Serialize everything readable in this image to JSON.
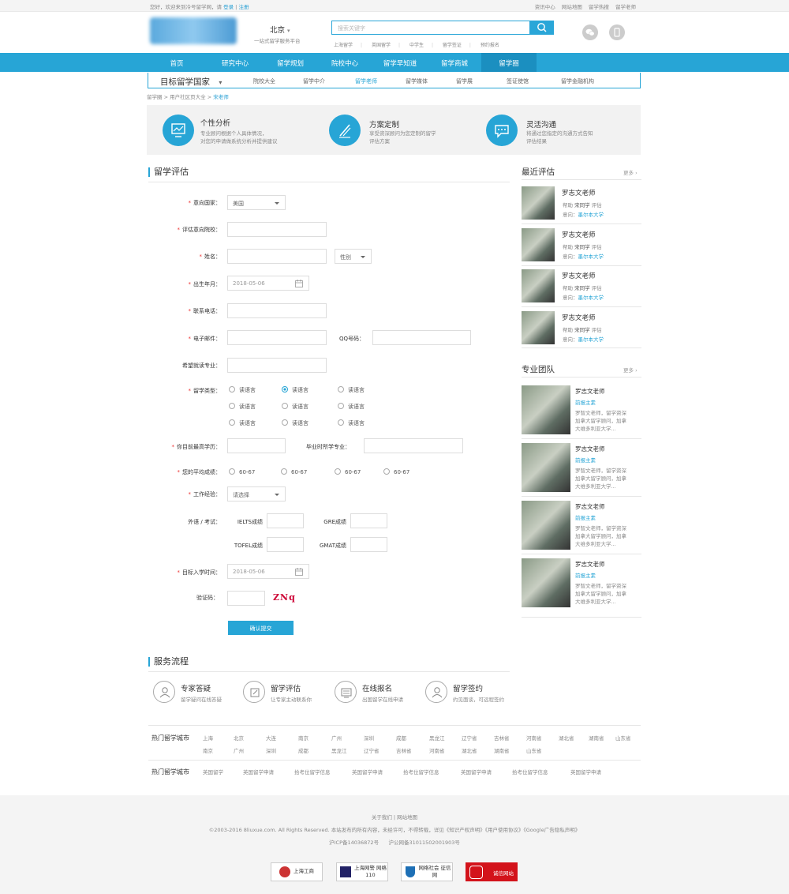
{
  "topbar": {
    "welcome": "您好，欢迎来到冷号留学网，请",
    "login": "登录",
    "sep": "|",
    "register": "注册",
    "links": [
      "资讯中心",
      "网站地图",
      "留学热搜",
      "留学老师"
    ]
  },
  "header": {
    "city": "北京",
    "city_sub": "一站式留学服务平台",
    "search_placeholder": "搜索关键字",
    "hotwords": [
      "上海留学",
      "英国留学",
      "中学生",
      "留学签证",
      "预约报名"
    ]
  },
  "nav": {
    "items": [
      "首页",
      "研究中心",
      "留学规划",
      "院校中心",
      "留学早知道",
      "留学商城",
      "留学圈"
    ],
    "active": 6
  },
  "subnav": {
    "title": "目标留学国家",
    "items": [
      "院校大全",
      "留学中介",
      "留学老师",
      "留学媒体",
      "留学展",
      "签证使馆",
      "留学金融机构"
    ],
    "active": 2
  },
  "breadcrumb": {
    "items": [
      "留学圈",
      "用户社区页大全"
    ],
    "current": "宋老师",
    "sep": ">"
  },
  "features": [
    {
      "title": "个性分析",
      "desc1": "专业顾问根据个人具体情况，",
      "desc2": "对您的申请做系统分析并提供建议"
    },
    {
      "title": "方案定制",
      "desc1": "享受资深顾问为您定制的留学",
      "desc2": "评估方案"
    },
    {
      "title": "灵活沟通",
      "desc1": "将通过您指定的沟通方式告知",
      "desc2": "评估结果"
    }
  ],
  "form": {
    "title": "留学评估",
    "required_mark": "*",
    "country_label": "意向国家：",
    "country_value": "美国",
    "school_label": "评估意向院校：",
    "name_label": "姓名：",
    "gender_value": "性别",
    "birth_label": "出生年月：",
    "birth_value": "2018-05-06",
    "phone_label": "联系电话：",
    "email_label": "电子邮件：",
    "qq_label": "QQ号码：",
    "major_label": "希望就读专业：",
    "type_label": "留学类型：",
    "type_options": [
      "读语言",
      "读语言",
      "读语言",
      "读语言",
      "读语言",
      "读语言",
      "读语言",
      "读语言",
      "读语言"
    ],
    "type_selected": 1,
    "edu_label": "你目前最高学历：",
    "grad_major_label": "毕业时所学专业：",
    "gpa_label": "您的平均成绩：",
    "gpa_options": [
      "60-67",
      "60-67",
      "60-67",
      "60-67"
    ],
    "work_label": "工作经验：",
    "work_value": "请选择",
    "lang_label": "外语 / 考试：",
    "ielts_label": "IELTS成绩",
    "gre_label": "GRE成绩",
    "toefl_label": "TOFEL成绩",
    "gmat_label": "GMAT成绩",
    "enroll_label": "目标入学时间：",
    "enroll_value": "2018-05-06",
    "captcha_label": "验证码：",
    "captcha_text": "ZNq",
    "submit": "确认提交"
  },
  "recent": {
    "title": "最近评估",
    "more": "更多",
    "items": [
      {
        "name": "罗志文老师",
        "help": "帮助",
        "student": "宋同学",
        "action": "评估",
        "intent": "意向：",
        "school": "墨尔本大学"
      },
      {
        "name": "罗志文老师",
        "help": "帮助",
        "student": "宋同学",
        "action": "评估",
        "intent": "意向：",
        "school": "墨尔本大学"
      },
      {
        "name": "罗志文老师",
        "help": "帮助",
        "student": "宋同学",
        "action": "评估",
        "intent": "意向：",
        "school": "墨尔本大学"
      },
      {
        "name": "罗志文老师",
        "help": "帮助",
        "student": "宋同学",
        "action": "评估",
        "intent": "意向：",
        "school": "墨尔本大学"
      }
    ]
  },
  "team": {
    "title": "专业团队",
    "more": "更多",
    "items": [
      {
        "name": "罗志文老师",
        "tag": "前报主素",
        "d1": "罗智文老师，留学资深",
        "d2": "加拿大留学顾问，加拿",
        "d3": "大维多利亚大学..."
      },
      {
        "name": "罗志文老师",
        "tag": "前报主素",
        "d1": "罗智文老师，留学资深",
        "d2": "加拿大留学顾问，加拿",
        "d3": "大维多利亚大学..."
      },
      {
        "name": "罗志文老师",
        "tag": "前报主素",
        "d1": "罗智文老师，留学资深",
        "d2": "加拿大留学顾问，加拿",
        "d3": "大维多利亚大学..."
      },
      {
        "name": "罗志文老师",
        "tag": "前报主素",
        "d1": "罗智文老师，留学资深",
        "d2": "加拿大留学顾问，加拿",
        "d3": "大维多利亚大学..."
      }
    ]
  },
  "process": {
    "title": "服务流程",
    "steps": [
      {
        "title": "专家答疑",
        "desc": "留学疑问在线答疑"
      },
      {
        "title": "留学评估",
        "desc": "让专家主动联系你"
      },
      {
        "title": "在线报名",
        "desc": "出国留学在线申请"
      },
      {
        "title": "留学签约",
        "desc": "约见面谈，可远程签约"
      }
    ]
  },
  "hotcities": {
    "label": "热门留学城市",
    "row1": [
      "上海",
      "北京",
      "大连",
      "南京",
      "广州",
      "深圳",
      "成都",
      "黑龙江",
      "辽宁省",
      "吉林省",
      "河南省",
      "湖北省",
      "湖南省",
      "山东省"
    ],
    "row2": [
      "南京",
      "广州",
      "深圳",
      "成都",
      "黑龙江",
      "辽宁省",
      "吉林省",
      "河南省",
      "湖北省",
      "湖南省",
      "山东省"
    ]
  },
  "hotcities2": {
    "label": "热门留学城市",
    "items": [
      "英国留学",
      "英国留学申请",
      "拾考位留学信息",
      "英国留学申请",
      "拾考位留学信息",
      "英国留学申请",
      "拾考位留学信息",
      "英国留学申请"
    ]
  },
  "footer": {
    "links": "关于我们 | 网站地图",
    "copyright": "©2003-2016 8liuxue.com. All Rights Reserved.   本站发布的所有内容，未经许可，不得转载，详见《知识产权声明》《用户使用协议》《Google广告隐私声明》",
    "icp1": "沪ICP备14036872号",
    "icp2": "沪公网备31011502001903号",
    "badges": [
      "上海工商",
      "上海网警 网络110",
      "网络社会 征信网",
      "诚信网站"
    ]
  }
}
